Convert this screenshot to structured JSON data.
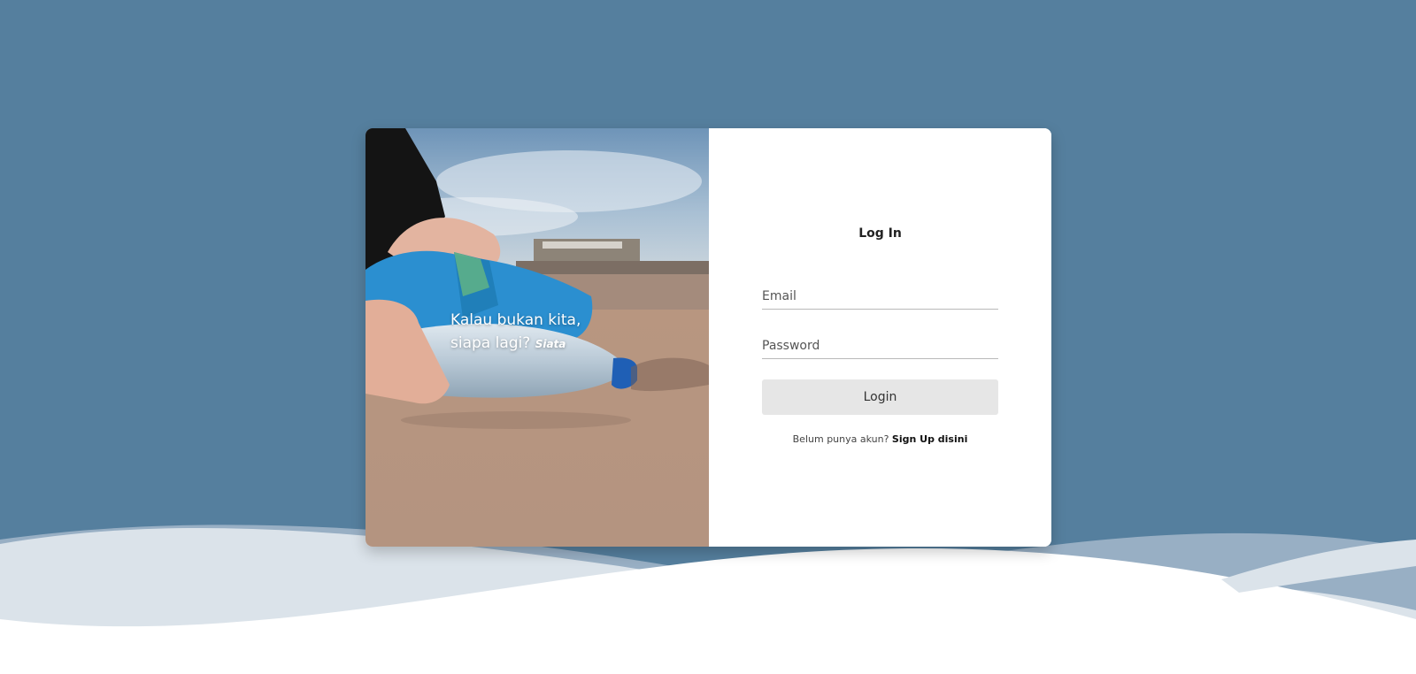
{
  "hero": {
    "tagline": "Kalau bukan kita, siapa lagi?",
    "brand": "Siata"
  },
  "login_form": {
    "title": "Log In",
    "email_placeholder": "Email",
    "password_placeholder": "Password",
    "login_button": "Login",
    "signup_prompt": "Belum punya akun?",
    "signup_link": "Sign Up disini"
  },
  "colors": {
    "background": "#557f9e",
    "card": "#ffffff",
    "button": "#e6e6e6",
    "wave_light": "#dbe3ea"
  }
}
